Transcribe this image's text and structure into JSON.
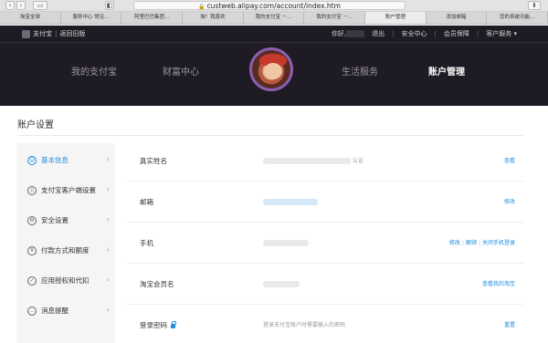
{
  "browser": {
    "url": "custweb.alipay.com/account/index.htm",
    "tabs": [
      "淘宝全球",
      "服务中心 常见...",
      "阿里巴巴集团...",
      "淘！我喜欢",
      "我的支付宝 －...",
      "我的支付宝 －...",
      "账户管理",
      "添加邮箱",
      "您的系统功能..."
    ]
  },
  "header": {
    "brand": "支付宝",
    "old_version": "返回旧版",
    "greeting": "你好,",
    "logout": "退出",
    "security_center": "安全中心",
    "member_protection": "会员保障",
    "customer_service": "客户服务 ▾",
    "nav": {
      "my_alipay": "我的支付宝",
      "wealth": "财富中心",
      "life": "生活服务",
      "account": "账户管理"
    }
  },
  "page": {
    "title": "账户设置"
  },
  "sidebar": {
    "items": [
      {
        "label": "基本信息",
        "icon": "user-icon"
      },
      {
        "label": "支付宝客户端设置",
        "icon": "phone-icon"
      },
      {
        "label": "安全设置",
        "icon": "gear-icon"
      },
      {
        "label": "付款方式和额度",
        "icon": "yen-icon"
      },
      {
        "label": "应用授权和代扣",
        "icon": "check-icon"
      },
      {
        "label": "消息提醒",
        "icon": "message-icon"
      }
    ]
  },
  "rows": [
    {
      "label": "真实姓名",
      "value_tail": "认证",
      "action": "查看"
    },
    {
      "label": "邮箱",
      "action": "修改"
    },
    {
      "label": "手机",
      "actions": [
        "修改",
        "解绑",
        "关闭手机登录"
      ]
    },
    {
      "label": "淘宝会员名",
      "action": "查看我的淘宝"
    },
    {
      "label": "登录密码",
      "value": "登录支付宝账户时需要输入的密码",
      "action": "重置"
    }
  ],
  "colors": {
    "accent": "#1f8fe0",
    "header_bg": "#1f1b24"
  }
}
